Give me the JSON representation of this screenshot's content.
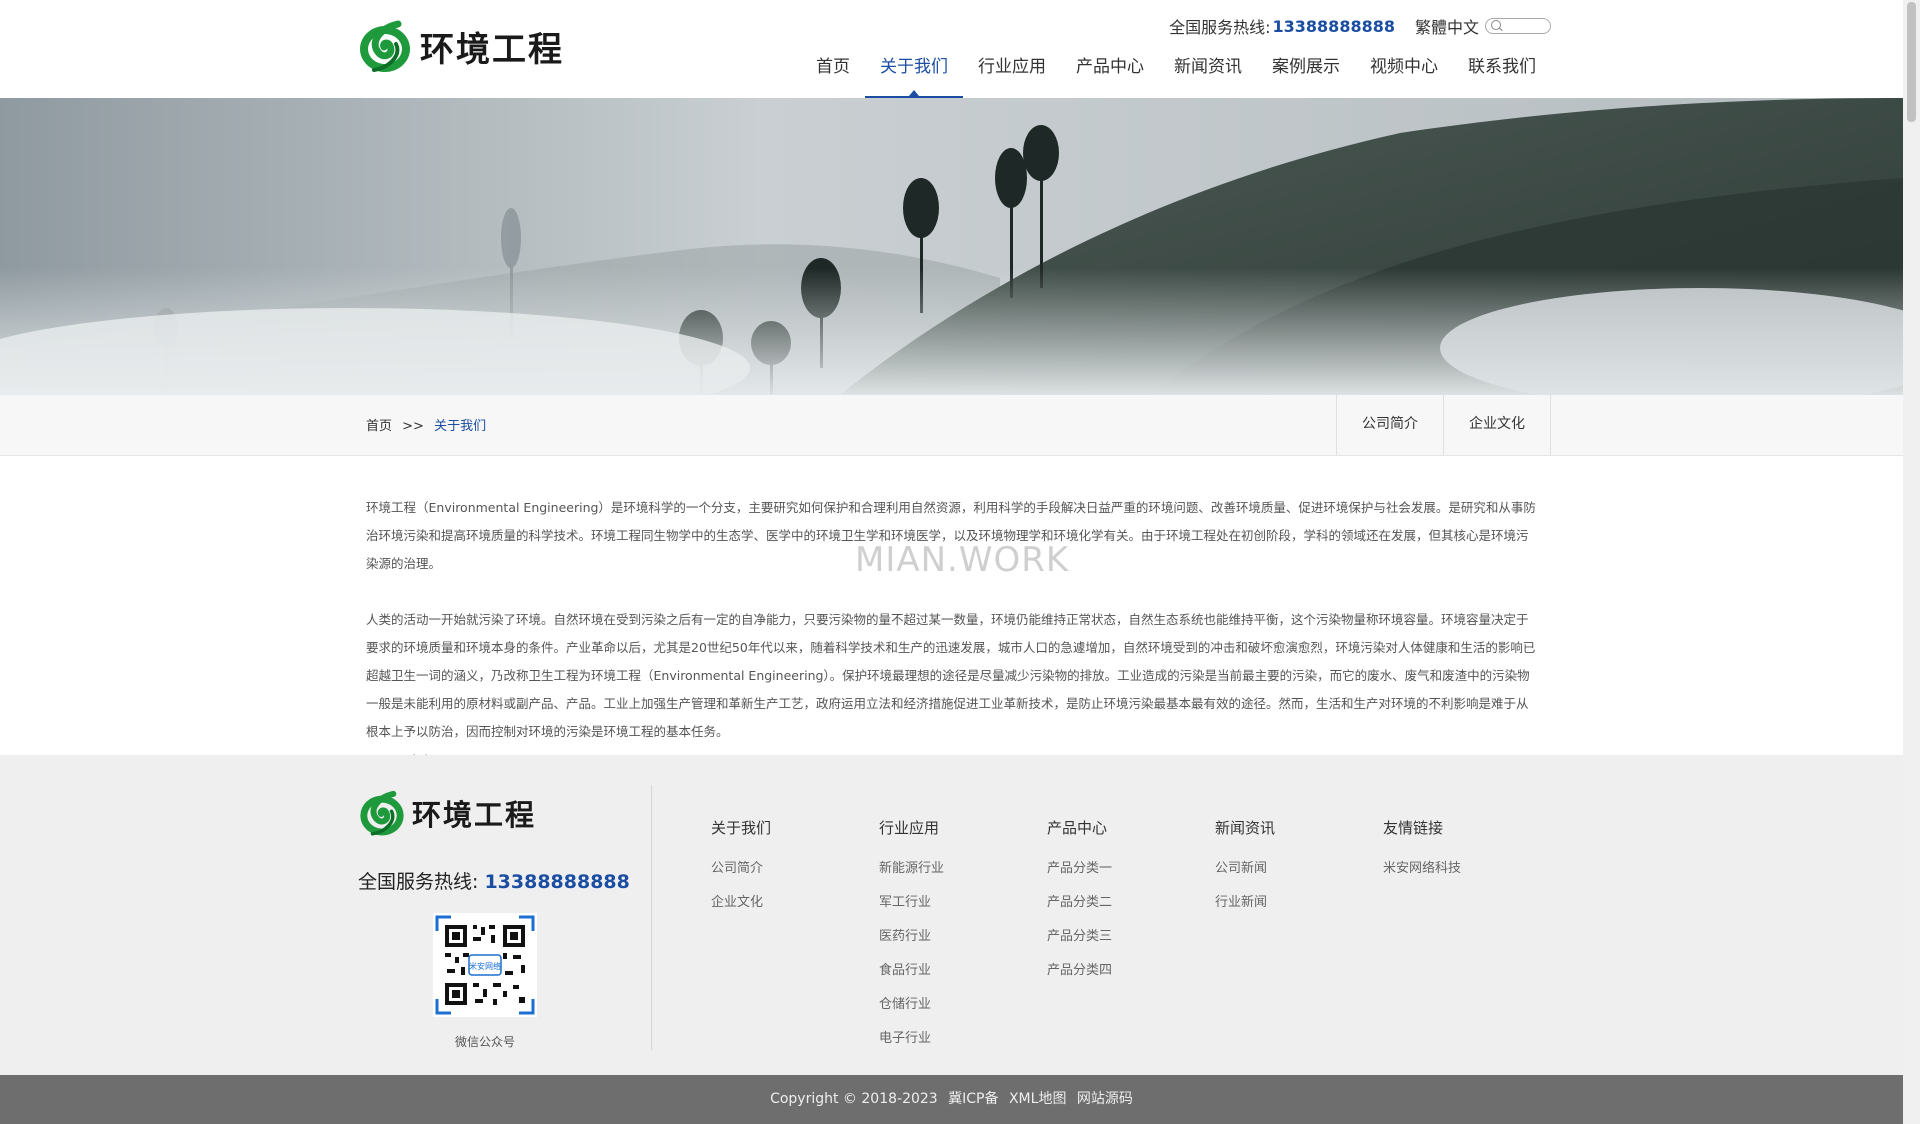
{
  "header": {
    "logo_text": "环境工程",
    "hotline_label": "全国服务热线:",
    "hotline_number": "13388888888",
    "lang_switch": "繁體中文",
    "nav": [
      "首页",
      "关于我们",
      "行业应用",
      "产品中心",
      "新闻资讯",
      "案例展示",
      "视频中心",
      "联系我们"
    ],
    "nav_active_index": 1
  },
  "breadcrumb": {
    "home": "首页",
    "sep": ">>",
    "current": "关于我们"
  },
  "subnav": [
    "公司简介",
    "企业文化"
  ],
  "watermark": "MIAN.WORK",
  "content": {
    "paragraph1": "环境工程（Environmental Engineering）是环境科学的一个分支，主要研究如何保护和合理利用自然资源，利用科学的手段解决日益严重的环境问题、改善环境质量、促进环境保护与社会发展。是研究和从事防治环境污染和提高环境质量的科学技术。环境工程同生物学中的生态学、医学中的环境卫生学和环境医学，以及环境物理学和环境化学有关。由于环境工程处在初创阶段，学科的领域还在发展，但其核心是环境污染源的治理。",
    "paragraph2": "人类的活动一开始就污染了环境。自然环境在受到污染之后有一定的自净能力，只要污染物的量不超过某一数量，环境仍能维持正常状态，自然生态系统也能维持平衡，这个污染物量称环境容量。环境容量决定于要求的环境质量和环境本身的条件。产业革命以后，尤其是20世纪50年代以来，随着科学技术和生产的迅速发展，城市人口的急遽增加，自然环境受到的冲击和破坏愈演愈烈，环境污染对人体健康和生活的影响已超越卫生一词的涵义，乃改称卫生工程为环境工程（Environmental Engineering）。保护环境最理想的途径是尽量减少污染物的排放。工业造成的污染是当前最主要的污染，而它的废水、废气和废渣中的污染物一般是未能利用的原材料或副产品、产品。工业上加强生产管理和革新生产工艺，政府运用立法和经济措施促进工业革新技术，是防止环境污染最基本最有效的途径。然而，生活和生产对环境的不利影响是难于从根本上予以防治，因而控制对环境的污染是环境工程的基本任务。",
    "signature": "WanWeiZhan.Com"
  },
  "footer": {
    "logo_text": "环境工程",
    "hotline_label": "全国服务热线:",
    "hotline_number": "13388888888",
    "qr_caption": "微信公众号",
    "qr_center_text": "米安网络",
    "columns": [
      {
        "title": "关于我们",
        "links": [
          "公司简介",
          "企业文化"
        ]
      },
      {
        "title": "行业应用",
        "links": [
          "新能源行业",
          "军工行业",
          "医药行业",
          "食品行业",
          "仓储行业",
          "电子行业"
        ]
      },
      {
        "title": "产品中心",
        "links": [
          "产品分类一",
          "产品分类二",
          "产品分类三",
          "产品分类四"
        ]
      },
      {
        "title": "新闻资讯",
        "links": [
          "公司新闻",
          "行业新闻"
        ]
      },
      {
        "title": "友情链接",
        "links": [
          "米安网络科技"
        ]
      }
    ]
  },
  "copyright": {
    "text": "Copyright © 2018-2023",
    "icp": "冀ICP备",
    "sitemap": "XML地图",
    "source": "网站源码"
  },
  "colors": {
    "accent": "#1b4ea2",
    "logo_green": "#1e9a3c",
    "footer_bg": "#efefef",
    "copyright_bg": "#6e6e6e"
  }
}
